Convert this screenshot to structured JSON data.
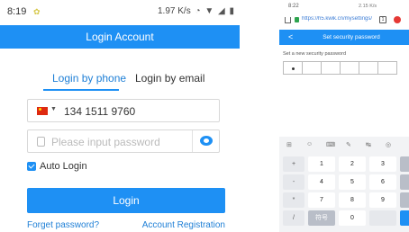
{
  "left_phone": {
    "status_bar": {
      "time": "8:19",
      "net_speed": "1.97 K/s"
    },
    "title": "Login Account",
    "tabs": [
      {
        "label": "Login by phone",
        "active": true
      },
      {
        "label": "Login by email",
        "active": false
      }
    ],
    "phone_field": {
      "value": "134 1511 9760",
      "country_flag": "china-flag-icon"
    },
    "password_field": {
      "placeholder": "Please input password"
    },
    "auto_login": {
      "label": "Auto Login",
      "checked": true
    },
    "login_button": "Login",
    "forgot_link": "Forget password?",
    "register_link": "Account Registration",
    "accent_color": "#1e90f4"
  },
  "right_phone": {
    "status_bar": {
      "time": "8:22",
      "net_speed": "2.15 K/s"
    },
    "url_bar": {
      "url": "https://h5.kwik.cn/mysettings/secu"
    },
    "title": "Set security password",
    "back_glyph": "<",
    "field_label": "Set a new security password",
    "pin_boxes": 6,
    "filled": 1,
    "keyboard": {
      "toolbar_icons": [
        "grid-icon",
        "emoji-icon",
        "keyboard-icon",
        "edit-icon",
        "cursor-icon",
        "mic-icon"
      ],
      "toolbar_glyphs": [
        "⊞",
        "☺",
        "⌨",
        "✎",
        "↹",
        "◎"
      ],
      "side_keys": [
        "+",
        "-",
        "*",
        "/"
      ],
      "rows": [
        [
          "1",
          "2",
          "3"
        ],
        [
          "4",
          "5",
          "6"
        ],
        [
          "7",
          "8",
          "9"
        ],
        [
          "",
          "0",
          ""
        ]
      ],
      "bottom_left": [
        "符号",
        "+"
      ]
    }
  }
}
